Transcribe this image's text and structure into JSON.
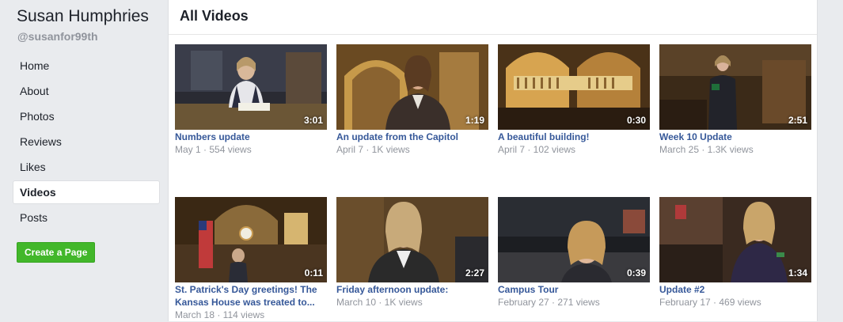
{
  "page": {
    "name": "Susan Humphries",
    "handle": "@susanfor99th"
  },
  "nav": [
    {
      "label": "Home"
    },
    {
      "label": "About"
    },
    {
      "label": "Photos"
    },
    {
      "label": "Reviews"
    },
    {
      "label": "Likes"
    },
    {
      "label": "Videos",
      "active": true
    },
    {
      "label": "Posts"
    }
  ],
  "create_page_label": "Create a Page",
  "main": {
    "title": "All Videos"
  },
  "videos": [
    {
      "title": "Numbers update",
      "meta": "May 1 · 554 views",
      "duration": "3:01"
    },
    {
      "title": "An update from the Capitol",
      "meta": "April 7 · 1K views",
      "duration": "1:19"
    },
    {
      "title": "A beautiful building!",
      "meta": "April 7 · 102 views",
      "duration": "0:30"
    },
    {
      "title": "Week 10 Update",
      "meta": "March 25 · 1.3K views",
      "duration": "2:51"
    },
    {
      "title": "St. Patrick's Day greetings! The Kansas House was treated to...",
      "meta": "March 18 · 114 views",
      "duration": "0:11"
    },
    {
      "title": "Friday afternoon update:",
      "meta": "March 10 · 1K views",
      "duration": "2:27"
    },
    {
      "title": "Campus Tour",
      "meta": "February 27 · 271 views",
      "duration": "0:39"
    },
    {
      "title": "Update #2",
      "meta": "February 17 · 469 views",
      "duration": "1:34"
    }
  ],
  "colors": {
    "link": "#365899",
    "meta": "#90949c",
    "green": "#42b72a",
    "bg": "#e9ebee"
  }
}
